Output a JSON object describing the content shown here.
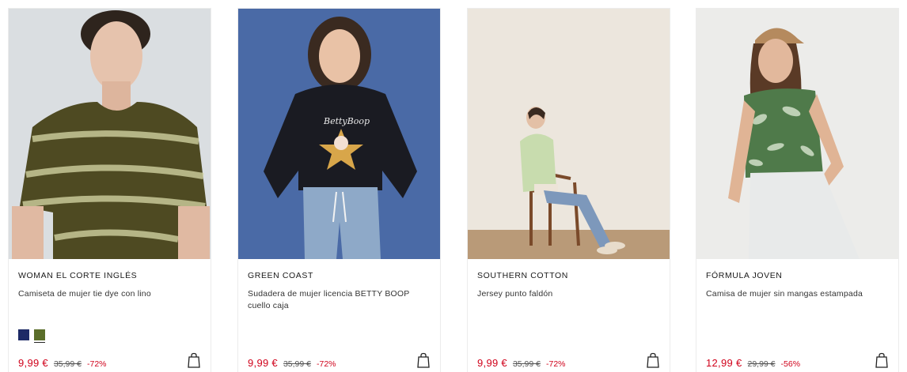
{
  "products": [
    {
      "brand": "WOMAN EL CORTE INGLÉS",
      "description": "Camiseta de mujer tie dye con lino",
      "price": "9,99 €",
      "old_price": "35,99 €",
      "discount": "-72%",
      "colors": [
        "#1d2a66",
        "#5b6e2a"
      ],
      "selected_color": 1,
      "photo_bg": "#d8dcdf",
      "photo_garment": "#4e4a22"
    },
    {
      "brand": "GREEN COAST",
      "description": "Sudadera de mujer licencia BETTY BOOP cuello caja",
      "price": "9,99 €",
      "old_price": "35,99 €",
      "discount": "-72%",
      "photo_bg": "#4a6aa6",
      "photo_garment": "#1a1b22",
      "print_text": "BettyBoop"
    },
    {
      "brand": "SOUTHERN COTTON",
      "description": "Jersey punto faldón",
      "price": "9,99 €",
      "old_price": "35,99 €",
      "discount": "-72%",
      "photo_bg": "#ece6dd",
      "photo_garment": "#c8dcae"
    },
    {
      "brand": "FÓRMULA JOVEN",
      "description": "Camisa de mujer sin mangas estampada",
      "price": "12,99 €",
      "old_price": "29,99 €",
      "discount": "-56%",
      "photo_bg": "#ececea",
      "photo_garment": "#4f7a4a"
    }
  ],
  "icons": {
    "bag": "shopping-bag-icon"
  }
}
